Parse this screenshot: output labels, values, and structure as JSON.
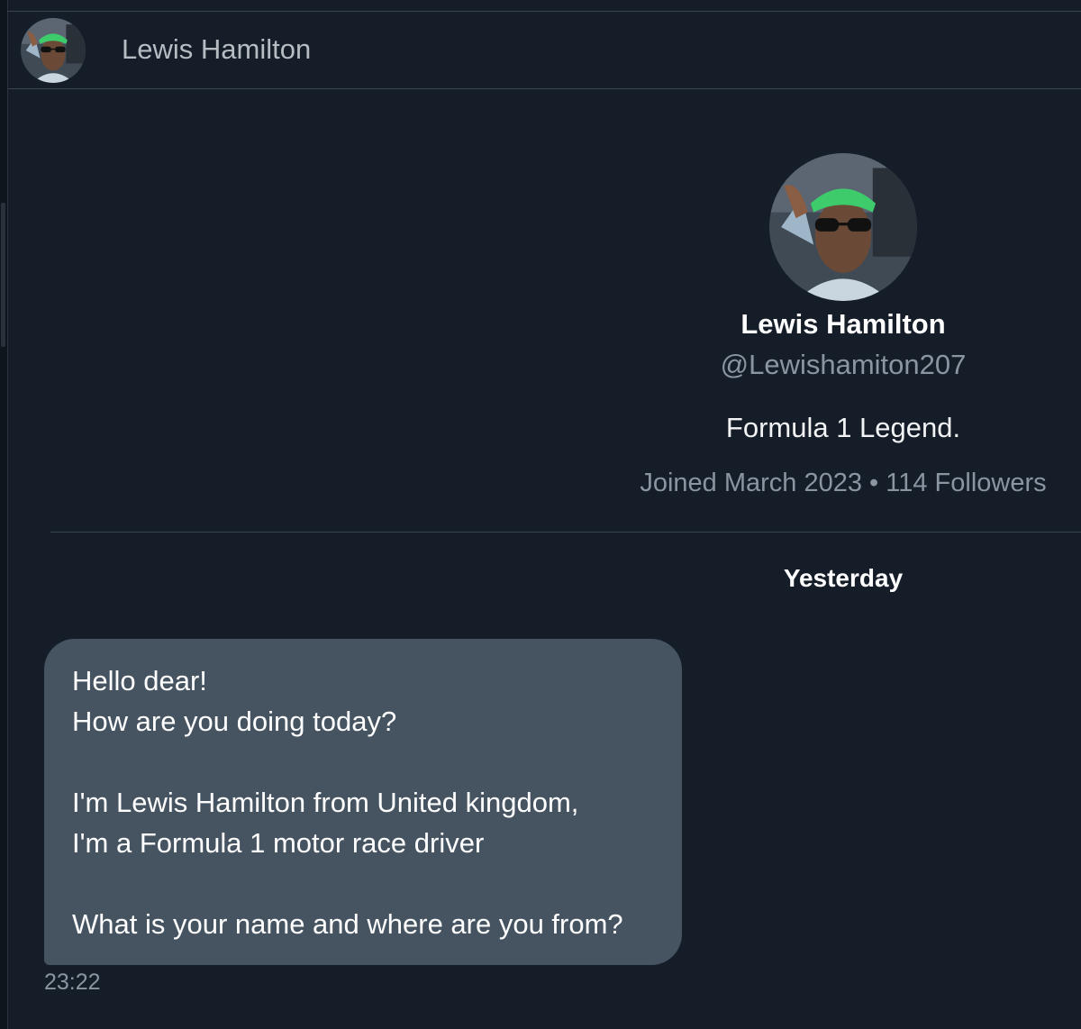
{
  "header": {
    "name": "Lewis Hamilton"
  },
  "profile": {
    "name": "Lewis Hamilton",
    "handle": "@Lewishamiton207",
    "bio": "Formula 1 Legend.",
    "meta": "Joined March 2023 • 114 Followers"
  },
  "conversation": {
    "day_label": "Yesterday",
    "message": {
      "line1": "Hello dear!",
      "line2": "How are you doing today?",
      "line3": "I'm Lewis Hamilton from United kingdom,",
      "line4": "I'm a Formula 1 motor race driver",
      "line5": "What is your name and where are you from?",
      "time": "23:22"
    }
  },
  "colors": {
    "background": "#151d29",
    "bubble": "#465462",
    "muted_text": "#8b95a1",
    "hat_green": "#3ecb6b"
  },
  "icons": {
    "avatar": "profile-photo"
  }
}
